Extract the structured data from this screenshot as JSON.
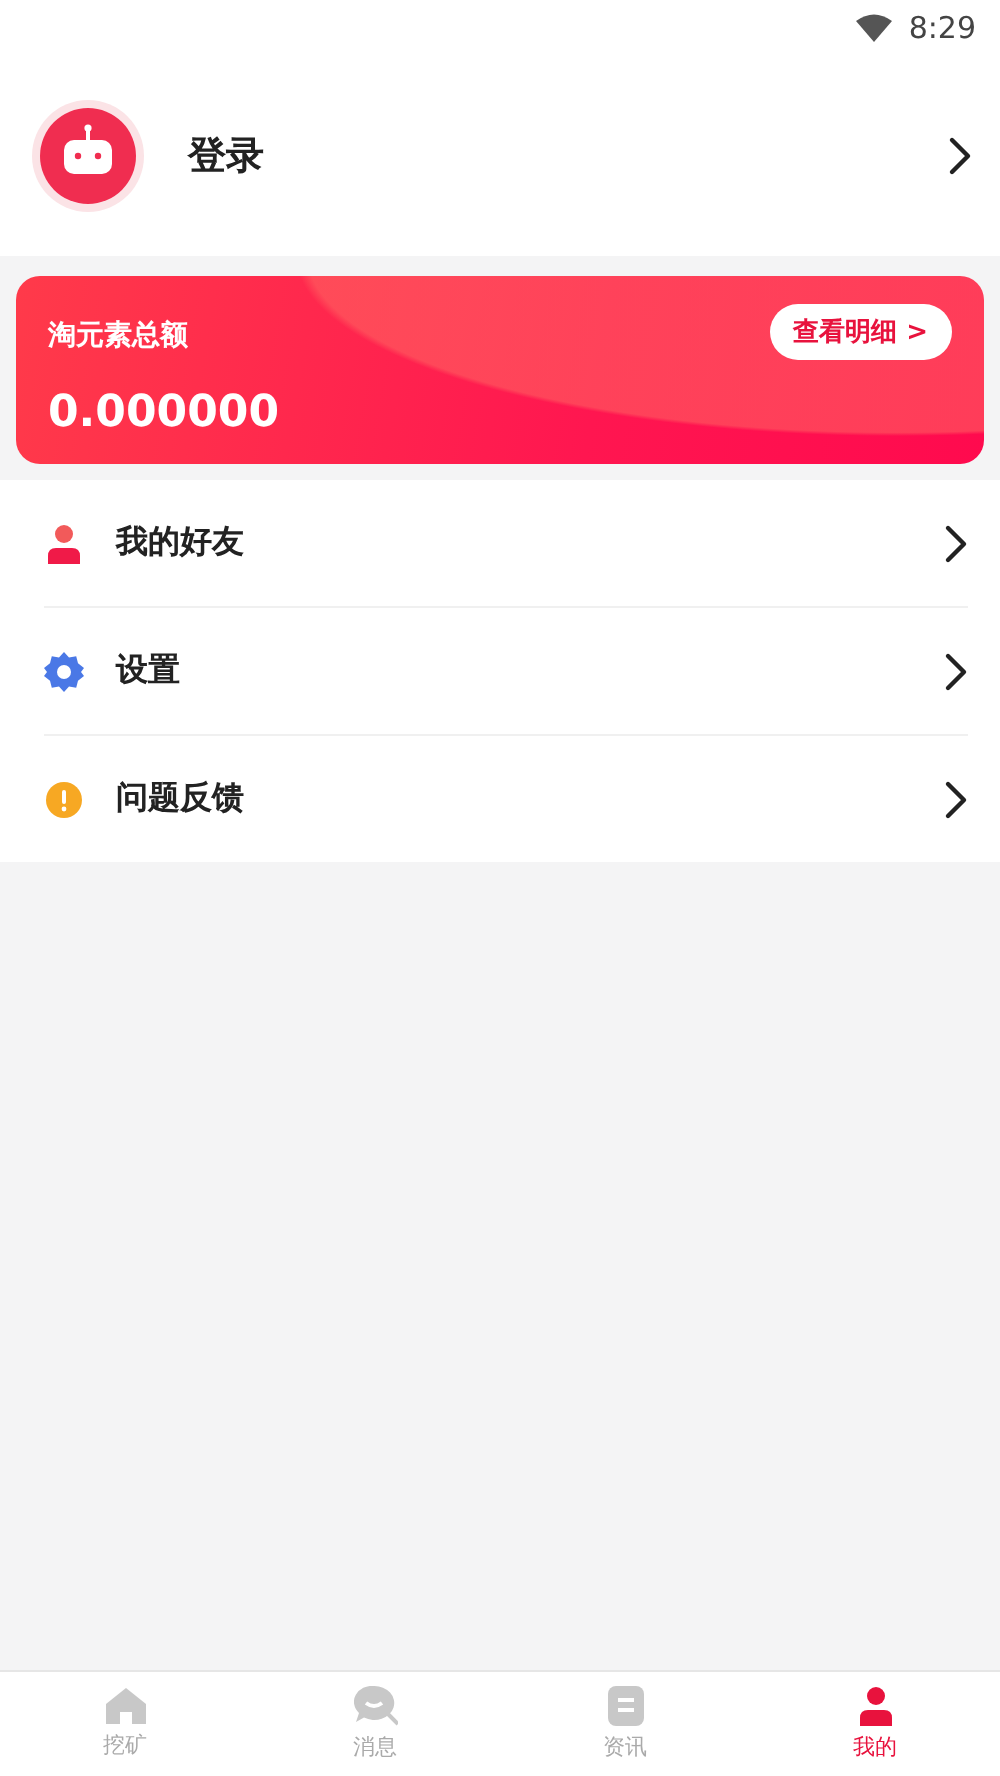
{
  "status_bar": {
    "time": "8:29"
  },
  "profile": {
    "name": "登录"
  },
  "balance_card": {
    "title": "淘元素总额",
    "amount": "0.000000",
    "button": "查看明细 >"
  },
  "menu": [
    {
      "kind": "friends",
      "label": "我的好友"
    },
    {
      "kind": "settings",
      "label": "设置"
    },
    {
      "kind": "feedback",
      "label": "问题反馈"
    }
  ],
  "tab_bar": [
    {
      "kind": "mine",
      "label": "挖矿",
      "selected": false
    },
    {
      "kind": "chat",
      "label": "消息",
      "selected": false
    },
    {
      "kind": "news",
      "label": "资讯",
      "selected": false
    },
    {
      "kind": "me",
      "label": "我的",
      "selected": true
    }
  ]
}
